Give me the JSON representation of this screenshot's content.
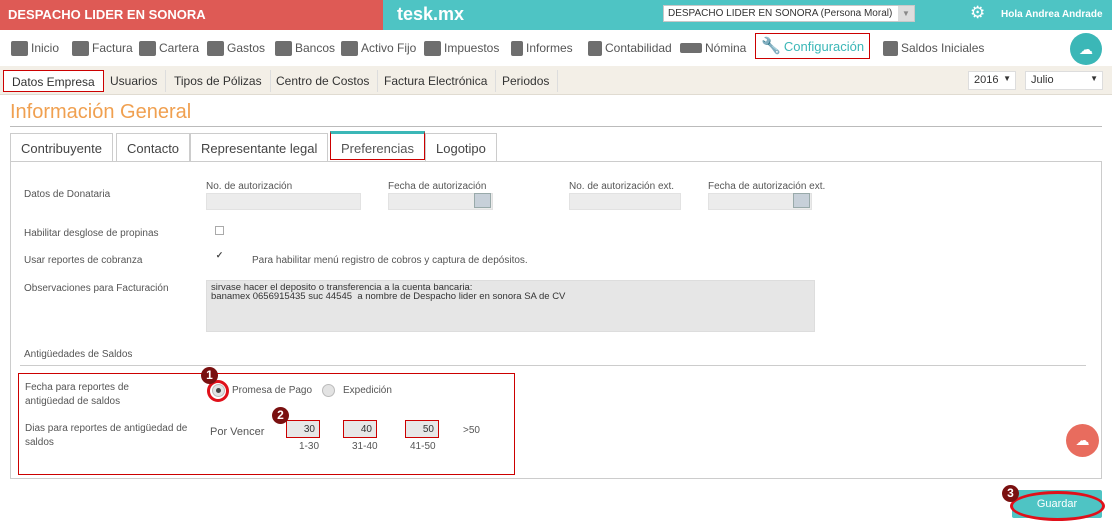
{
  "topbar": {
    "company_name": "DESPACHO LIDER EN SONORA",
    "app_name": "tesk.mx",
    "company_select": "DESPACHO LIDER EN SONORA (Persona Moral)",
    "greeting": "Hola Andrea Andrade"
  },
  "menu": {
    "items": [
      {
        "label": "Inicio",
        "icon": "cloud-icon"
      },
      {
        "label": "Factura",
        "icon": "tag-icon"
      },
      {
        "label": "Cartera",
        "icon": "wallet-icon"
      },
      {
        "label": "Gastos",
        "icon": "cart-icon"
      },
      {
        "label": "Bancos",
        "icon": "bank-icon"
      },
      {
        "label": "Activo Fijo",
        "icon": "house-icon"
      },
      {
        "label": "Impuestos",
        "icon": "briefcase-icon"
      },
      {
        "label": "Informes",
        "icon": "document-icon"
      },
      {
        "label": "Contabilidad",
        "icon": "calculator-icon"
      },
      {
        "label": "Nómina",
        "icon": "id-card-icon"
      },
      {
        "label": "Configuración",
        "icon": "wrench-icon"
      },
      {
        "label": "Saldos Iniciales",
        "icon": "gear-doc-icon"
      }
    ]
  },
  "subnav": {
    "items": [
      "Datos Empresa",
      "Usuarios",
      "Tipos de Pólizas",
      "Centro de Costos",
      "Factura Electrónica",
      "Periodos"
    ],
    "year": "2016",
    "month": "Julio"
  },
  "page": {
    "title": "Información General",
    "tabs": [
      "Contribuyente",
      "Contacto",
      "Representante legal",
      "Preferencias",
      "Logotipo"
    ]
  },
  "form": {
    "donataria_label": "Datos de Donataria",
    "no_autorizacion": "No. de autorización",
    "fecha_autorizacion": "Fecha de autorización",
    "no_autorizacion_ext": "No. de autorización ext.",
    "fecha_autorizacion_ext": "Fecha de autorización ext.",
    "propinas_label": "Habilitar desglose de propinas",
    "cobranza_label": "Usar reportes de cobranza",
    "cobranza_note": "Para habilitar menú registro de cobros y captura de depósitos.",
    "obs_label": "Observaciones para Facturación",
    "obs_value": "sirvase hacer el deposito o transferencia a la cuenta bancaria:\nbanamex 0656915435 suc 44545  a nombre de Despacho lider en sonora SA de CV",
    "section_title": "Antigüedades de Saldos",
    "fecha_reportes_label": "Fecha para reportes de antigüedad de saldos",
    "radio_promesa": "Promesa de Pago",
    "radio_expedicion": "Expedición",
    "dias_label": "Dias para reportes de antigüedad de saldos",
    "por_vencer": "Por Vencer",
    "days": [
      {
        "value": "30",
        "range": "1-30"
      },
      {
        "value": "40",
        "range": "31-40"
      },
      {
        "value": "50",
        "range": "41-50"
      }
    ],
    "over": ">50"
  },
  "badges": [
    "1",
    "2",
    "3"
  ],
  "save_label": "Guardar"
}
